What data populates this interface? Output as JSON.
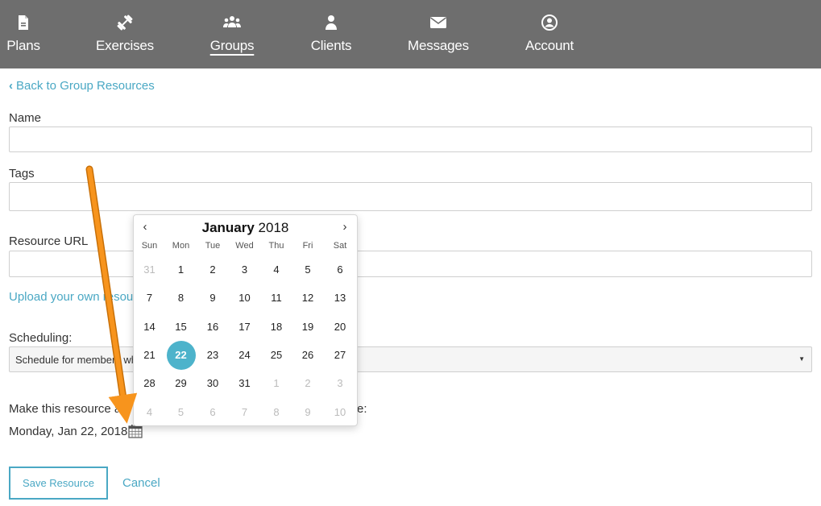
{
  "nav": {
    "items": [
      {
        "label": "Plans",
        "icon": "document-icon"
      },
      {
        "label": "Exercises",
        "icon": "dumbbell-icon"
      },
      {
        "label": "Groups",
        "icon": "group-icon"
      },
      {
        "label": "Clients",
        "icon": "user-icon"
      },
      {
        "label": "Messages",
        "icon": "envelope-icon"
      },
      {
        "label": "Account",
        "icon": "account-circle-icon"
      }
    ],
    "active": "Groups"
  },
  "back_link": "Back to Group Resources",
  "form": {
    "name_label": "Name",
    "name_value": "",
    "tags_label": "Tags",
    "tags_value": "",
    "url_label": "Resource URL",
    "url_value": "",
    "upload_link": "Upload your own resou",
    "scheduling_label": "Scheduling:",
    "scheduling_selected": "Schedule for members wh",
    "availability_label": "Make this resource av",
    "availability_label_tail": "e:",
    "availability_date": "Monday, Jan 22, 2018",
    "save_button": "Save Resource",
    "cancel_link": "Cancel"
  },
  "datepicker": {
    "month": "January",
    "year": "2018",
    "weekdays": [
      "Sun",
      "Mon",
      "Tue",
      "Wed",
      "Thu",
      "Fri",
      "Sat"
    ],
    "weeks": [
      [
        "31",
        "1",
        "2",
        "3",
        "4",
        "5",
        "6"
      ],
      [
        "7",
        "8",
        "9",
        "10",
        "11",
        "12",
        "13"
      ],
      [
        "14",
        "15",
        "16",
        "17",
        "18",
        "19",
        "20"
      ],
      [
        "21",
        "22",
        "23",
        "24",
        "25",
        "26",
        "27"
      ],
      [
        "28",
        "29",
        "30",
        "31",
        "1",
        "2",
        "3"
      ],
      [
        "4",
        "5",
        "6",
        "7",
        "8",
        "9",
        "10"
      ]
    ],
    "muted": [
      [
        0,
        0
      ],
      [
        4,
        4
      ],
      [
        4,
        5
      ],
      [
        4,
        6
      ],
      [
        5,
        0
      ],
      [
        5,
        1
      ],
      [
        5,
        2
      ],
      [
        5,
        3
      ],
      [
        5,
        4
      ],
      [
        5,
        5
      ],
      [
        5,
        6
      ]
    ],
    "selected": [
      3,
      1
    ]
  },
  "colors": {
    "nav_bg": "#6e6e6e",
    "accent": "#4aa8c4",
    "selected_day": "#4db3cb",
    "annotation_arrow": "#f7941d"
  }
}
